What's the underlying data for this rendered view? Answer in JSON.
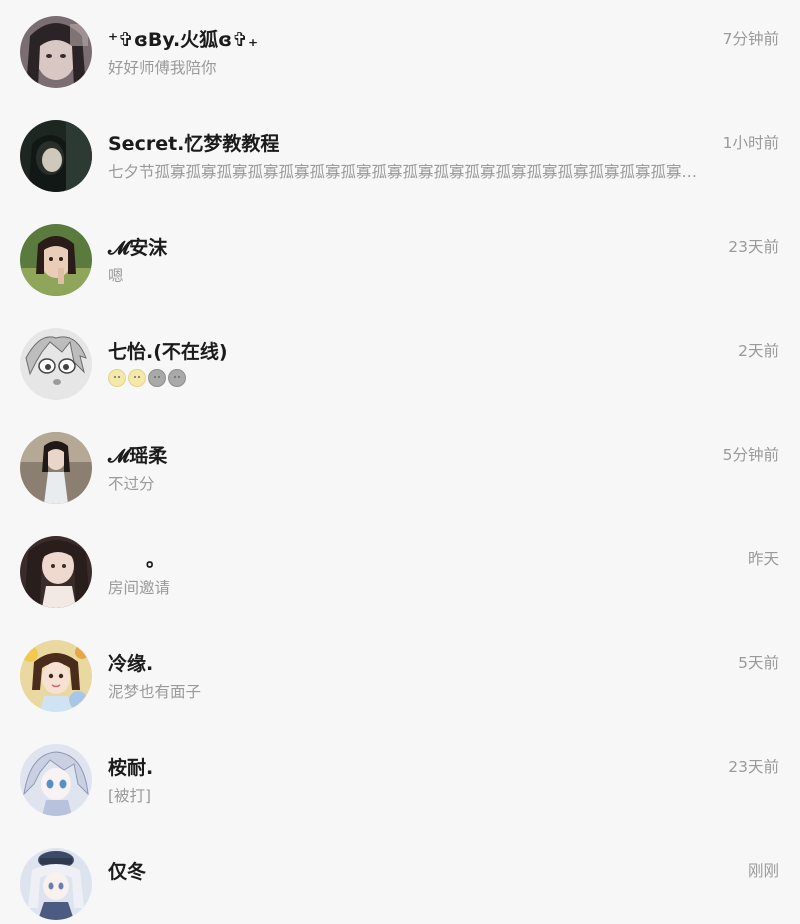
{
  "conversations": [
    {
      "name": "⁺✞ɞBy.火狐ɞ✞₊",
      "time": "7分钟前",
      "message": "好好师傅我陪你",
      "avatar": "avatar-dark-hair-girl"
    },
    {
      "name": "Secret.忆梦教教程",
      "time": "1小时前",
      "message": "七夕节孤寡孤寡孤寡孤寡孤寡孤寡孤寡孤寡孤寡孤寡孤寡孤寡孤寡孤寡孤寡孤寡孤寡孤寡孤寡...",
      "avatar": "avatar-dark-photo"
    },
    {
      "name": "𝓜安沫",
      "time": "23天前",
      "message": "嗯",
      "avatar": "avatar-girl-green"
    },
    {
      "name": "七怡.(不在线)",
      "time": "2天前",
      "message": "",
      "emojis": [
        "smile-face",
        "smile-face",
        "gray-face",
        "gray-face"
      ],
      "avatar": "avatar-manga-sketch"
    },
    {
      "name": "𝓜瑶柔",
      "time": "5分钟前",
      "message": "不过分",
      "avatar": "avatar-girl-dress"
    },
    {
      "name": "　　。",
      "time": "昨天",
      "message": "房间邀请",
      "avatar": "avatar-girl-closeup"
    },
    {
      "name": "冷缘.",
      "time": "5天前",
      "message": "泥梦也有面子",
      "avatar": "avatar-girl-flowers"
    },
    {
      "name": "桉耐.",
      "time": "23天前",
      "message": "[被打]",
      "avatar": "avatar-anime-blue"
    },
    {
      "name": "仅冬",
      "time": "刚刚",
      "message": "",
      "avatar": "avatar-anime-cap"
    }
  ]
}
